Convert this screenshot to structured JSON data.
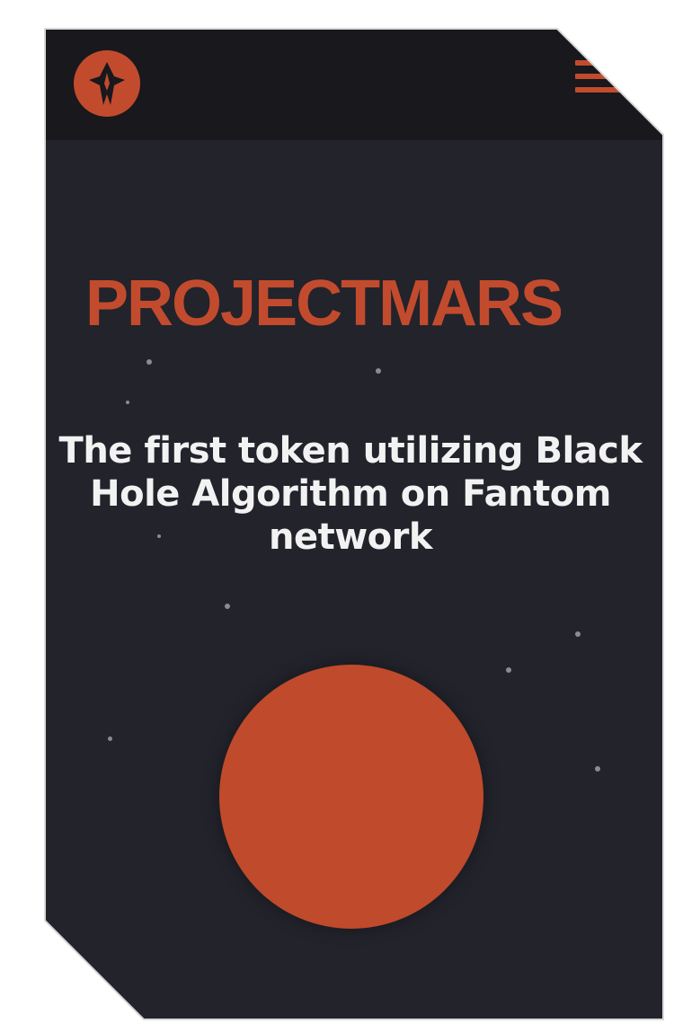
{
  "header": {
    "logo_icon": "rocket-emblem-icon",
    "menu_icon": "hamburger-menu-icon"
  },
  "hero": {
    "brand_name": "PROJECTMARS",
    "tagline": "The first token utilizing Black Hole Algorithm on Fantom network"
  },
  "colors": {
    "accent": "#c24b2e",
    "background": "#22232b",
    "header_background": "#18181d",
    "text": "#f2f2f2"
  }
}
